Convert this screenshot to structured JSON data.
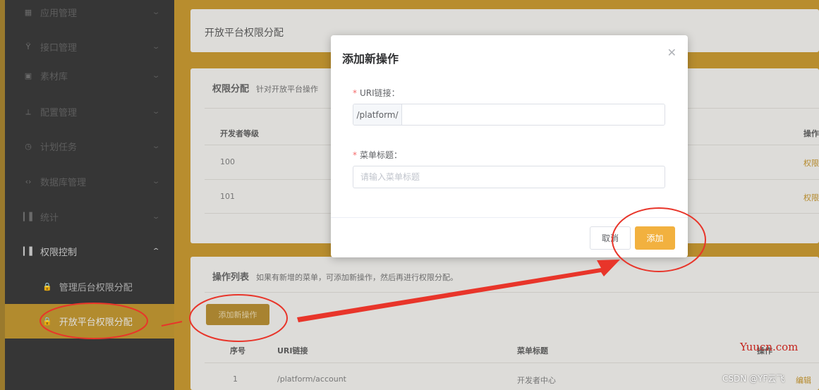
{
  "sidebar": {
    "items": [
      {
        "label": "应用管理",
        "icon": "grid-icon"
      },
      {
        "label": "接口管理",
        "icon": "api-icon"
      },
      {
        "label": "素材库",
        "icon": "image-icon"
      },
      {
        "label": "配置管理",
        "icon": "wrench-icon"
      },
      {
        "label": "计划任务",
        "icon": "clock-icon"
      },
      {
        "label": "数据库管理",
        "icon": "code-icon"
      },
      {
        "label": "统计",
        "icon": "bar-chart-icon"
      },
      {
        "label": "权限控制",
        "icon": "bar-chart-icon"
      }
    ],
    "sub_items": [
      {
        "label": "管理后台权限分配",
        "icon": "lock-icon"
      },
      {
        "label": "开放平台权限分配",
        "icon": "lock-icon"
      }
    ]
  },
  "page": {
    "title": "开放平台权限分配"
  },
  "permission_card": {
    "title": "权限分配",
    "desc": "针对开放平台操作",
    "columns": [
      "开发者等级",
      "操作"
    ],
    "rows": [
      {
        "level": "100",
        "action": "权限"
      },
      {
        "level": "101",
        "action": "权限"
      }
    ]
  },
  "operations_card": {
    "title": "操作列表",
    "desc": "如果有新增的菜单，可添加新操作，然后再进行权限分配。",
    "add_button": "添加新操作",
    "columns": [
      "序号",
      "URI链接",
      "菜单标题",
      "操作"
    ],
    "rows": [
      {
        "index": "1",
        "uri": "/platform/account",
        "title": "开发者中心",
        "action": "编辑"
      }
    ]
  },
  "modal": {
    "title": "添加新操作",
    "uri_label": "URI链接：",
    "uri_prefix": "/platform/",
    "uri_value": "",
    "menu_title_label": "菜单标题：",
    "menu_title_placeholder": "请输入菜单标题",
    "cancel": "取消",
    "add": "添加"
  },
  "watermarks": {
    "site": "Yuucn.com",
    "author": "CSDN @YF云飞"
  },
  "colors": {
    "accent": "#f2b13f",
    "annotation": "#e8352a",
    "required": "#f56c6c"
  }
}
